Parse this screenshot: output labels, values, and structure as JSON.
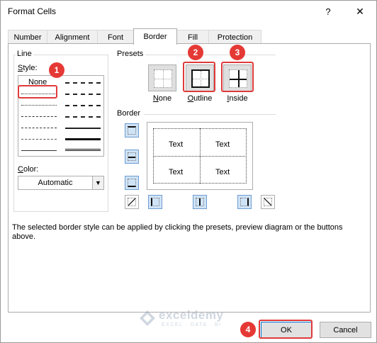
{
  "window": {
    "title": "Format Cells",
    "help": "?",
    "close": "✕"
  },
  "tabs": [
    {
      "label": "Number",
      "active": false
    },
    {
      "label": "Alignment",
      "active": false
    },
    {
      "label": "Font",
      "active": false
    },
    {
      "label": "Border",
      "active": true
    },
    {
      "label": "Fill",
      "active": false
    },
    {
      "label": "Protection",
      "active": false
    }
  ],
  "line": {
    "group_label": "Line",
    "style_label": "Style:",
    "none_label": "None",
    "color_label": "Color:",
    "color_value": "Automatic"
  },
  "presets": {
    "group_label": "Presets",
    "items": [
      {
        "label": "None",
        "icon": "preset-none-icon"
      },
      {
        "label": "Outline",
        "icon": "preset-outline-icon"
      },
      {
        "label": "Inside",
        "icon": "preset-inside-icon"
      }
    ]
  },
  "border": {
    "group_label": "Border",
    "preview_texts": [
      "Text",
      "Text",
      "Text",
      "Text"
    ]
  },
  "description": "The selected border style can be applied by clicking the presets, preview diagram or the buttons above.",
  "buttons": {
    "ok": "OK",
    "cancel": "Cancel"
  },
  "badges": [
    "1",
    "2",
    "3",
    "4"
  ],
  "watermark": {
    "name": "exceldemy",
    "tagline": "EXCEL · DATA · BI"
  },
  "colors": {
    "highlight": "#e03a3a",
    "badge": "#e53935",
    "accent_border": "#0078d7"
  }
}
